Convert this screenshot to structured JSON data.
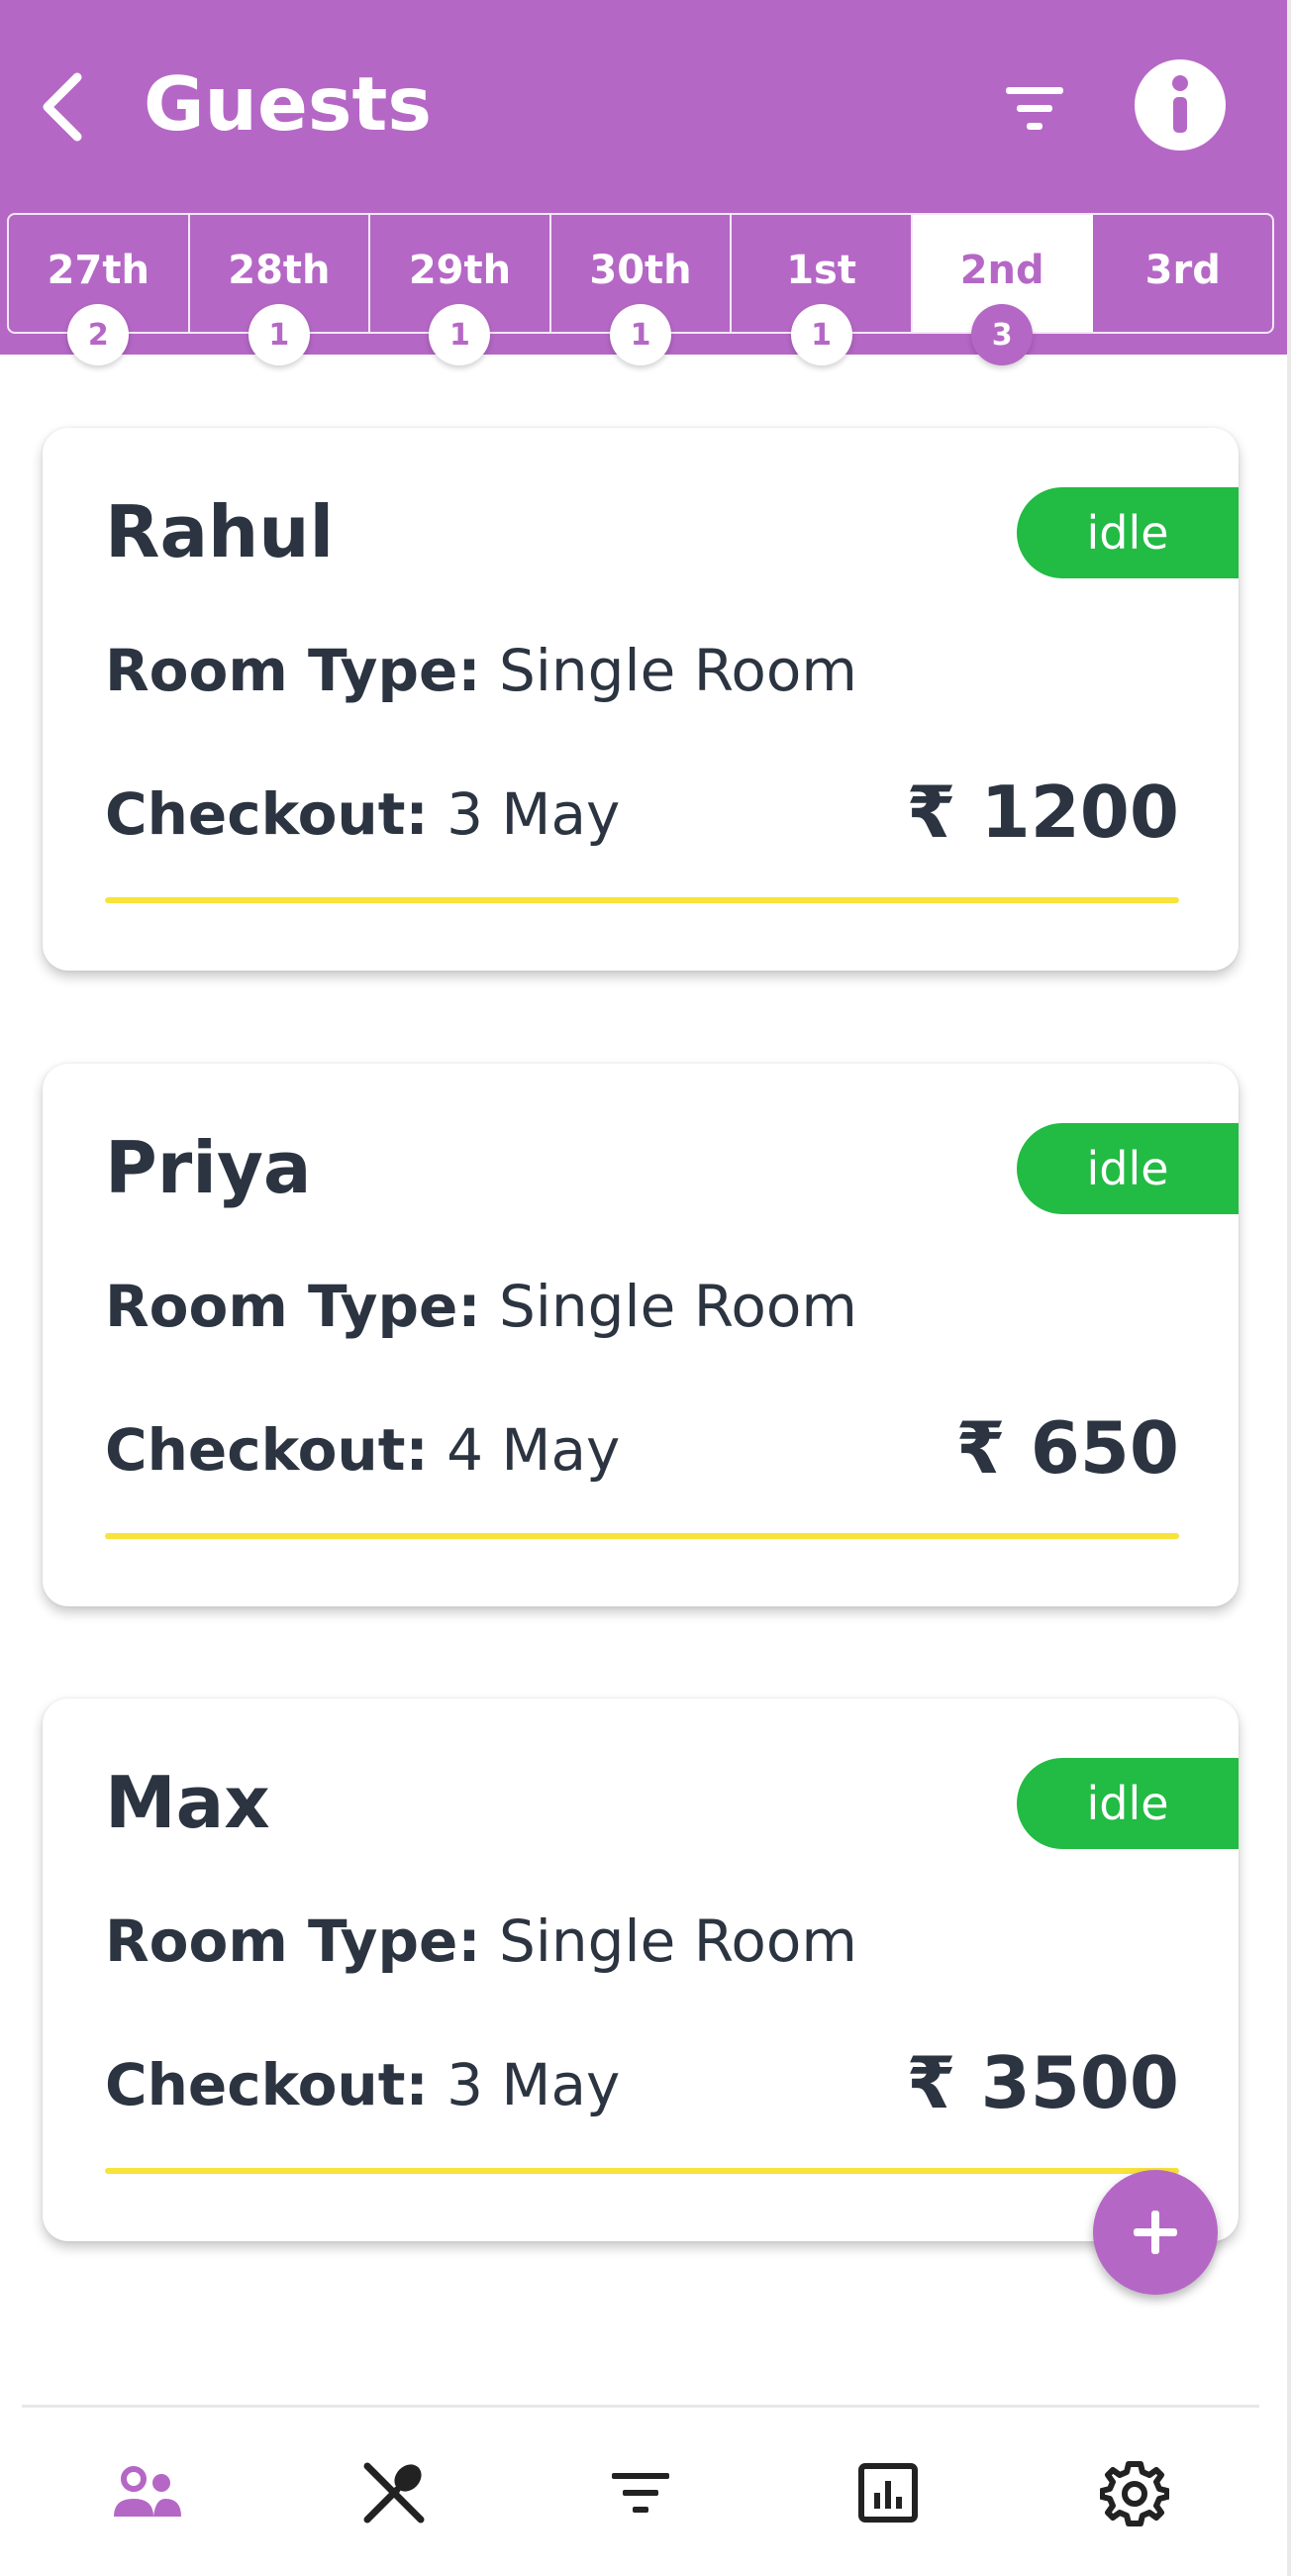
{
  "header": {
    "title": "Guests",
    "bg_color": "#b567c6",
    "back_icon": "chevron-left-icon",
    "filter_icon": "filter-icon",
    "info_icon": "info-icon"
  },
  "tabs": [
    {
      "label": "27th",
      "count": "2",
      "active": false
    },
    {
      "label": "28th",
      "count": "1",
      "active": false
    },
    {
      "label": "29th",
      "count": "1",
      "active": false
    },
    {
      "label": "30th",
      "count": "1",
      "active": false
    },
    {
      "label": "1st",
      "count": "1",
      "active": false
    },
    {
      "label": "2nd",
      "count": "3",
      "active": true
    },
    {
      "label": "3rd",
      "count": "",
      "active": false
    }
  ],
  "guests": [
    {
      "name": "Rahul",
      "status": "idle",
      "room_type_label": "Room Type:",
      "room_type": "Single Room",
      "checkout_label": "Checkout:",
      "checkout": "3 May",
      "price": "₹ 1200"
    },
    {
      "name": "Priya",
      "status": "idle",
      "room_type_label": "Room Type:",
      "room_type": "Single Room",
      "checkout_label": "Checkout:",
      "checkout": "4 May",
      "price": "₹ 650"
    },
    {
      "name": "Max",
      "status": "idle",
      "room_type_label": "Room Type:",
      "room_type": "Single Room",
      "checkout_label": "Checkout:",
      "checkout": "3 May",
      "price": "₹ 3500"
    }
  ],
  "colors": {
    "accent": "#b567c6",
    "status_idle": "#22bb44",
    "underline": "#f7e33a",
    "text": "#2b3440",
    "nav_inactive": "#222222"
  },
  "fab": {
    "icon": "plus-icon"
  },
  "bottom_nav": [
    {
      "icon": "guests-icon",
      "active": true
    },
    {
      "icon": "fork-spoon-icon",
      "active": false
    },
    {
      "icon": "filter-icon",
      "active": false
    },
    {
      "icon": "bar-chart-icon",
      "active": false
    },
    {
      "icon": "gear-icon",
      "active": false
    }
  ]
}
